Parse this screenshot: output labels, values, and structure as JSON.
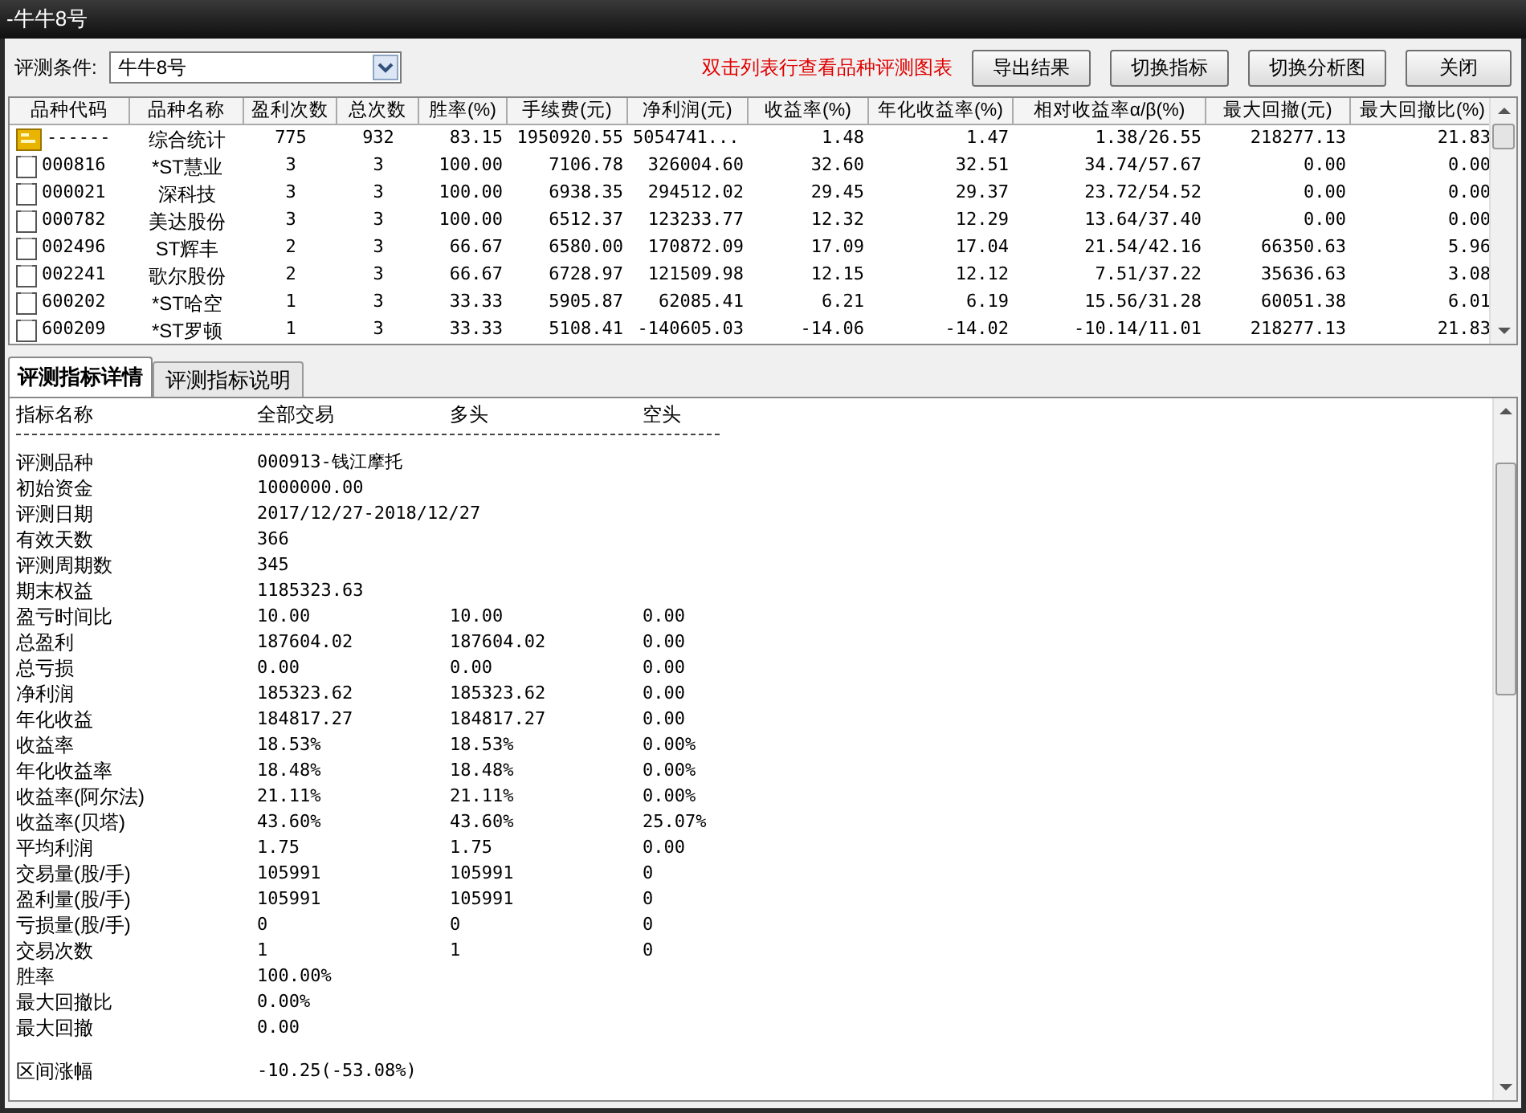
{
  "window": {
    "title": "-牛牛8号"
  },
  "toolbar": {
    "label": "评测条件:",
    "dropdown_value": "牛牛8号",
    "hint": "双击列表行查看品种评测图表",
    "buttons": [
      "导出结果",
      "切换指标",
      "切换分析图",
      "关闭"
    ]
  },
  "table": {
    "columns": [
      "品种代码",
      "品种名称",
      "盈利次数",
      "总次数",
      "胜率(%)",
      "手续费(元)",
      "净利润(元)",
      "收益率(%)",
      "年化收益率(%)",
      "相对收益率α/β(%)",
      "最大回撤(元)",
      "最大回撤比(%)"
    ],
    "rows": [
      {
        "kind": "summary",
        "cells": [
          "------",
          "综合统计",
          "775",
          "932",
          "83.15",
          "1950920.55",
          "5054741...",
          "1.48",
          "1.47",
          "1.38/26.55",
          "218277.13",
          "21.83"
        ]
      },
      {
        "kind": "stock",
        "cells": [
          "000816",
          "*ST慧业",
          "3",
          "3",
          "100.00",
          "7106.78",
          "326004.60",
          "32.60",
          "32.51",
          "34.74/57.67",
          "0.00",
          "0.00"
        ]
      },
      {
        "kind": "stock",
        "cells": [
          "000021",
          "深科技",
          "3",
          "3",
          "100.00",
          "6938.35",
          "294512.02",
          "29.45",
          "29.37",
          "23.72/54.52",
          "0.00",
          "0.00"
        ]
      },
      {
        "kind": "stock",
        "cells": [
          "000782",
          "美达股份",
          "3",
          "3",
          "100.00",
          "6512.37",
          "123233.77",
          "12.32",
          "12.29",
          "13.64/37.40",
          "0.00",
          "0.00"
        ]
      },
      {
        "kind": "stock",
        "cells": [
          "002496",
          "ST辉丰",
          "2",
          "3",
          "66.67",
          "6580.00",
          "170872.09",
          "17.09",
          "17.04",
          "21.54/42.16",
          "66350.63",
          "5.96"
        ]
      },
      {
        "kind": "stock",
        "cells": [
          "002241",
          "歌尔股份",
          "2",
          "3",
          "66.67",
          "6728.97",
          "121509.98",
          "12.15",
          "12.12",
          "7.51/37.22",
          "35636.63",
          "3.08"
        ]
      },
      {
        "kind": "stock",
        "cells": [
          "600202",
          "*ST哈空",
          "1",
          "3",
          "33.33",
          "5905.87",
          "62085.41",
          "6.21",
          "6.19",
          "15.56/31.28",
          "60051.38",
          "6.01"
        ]
      },
      {
        "kind": "stock",
        "cells": [
          "600209",
          "*ST罗顿",
          "1",
          "3",
          "33.33",
          "5108.41",
          "-140605.03",
          "-14.06",
          "-14.02",
          "-10.14/11.01",
          "218277.13",
          "21.83"
        ]
      }
    ]
  },
  "tabs": [
    {
      "label": "评测指标详情",
      "selected": true
    },
    {
      "label": "评测指标说明",
      "selected": false
    }
  ],
  "details": {
    "columns": [
      "指标名称",
      "全部交易",
      "多头",
      "空头"
    ],
    "rows": [
      {
        "cells": [
          "评测品种",
          "000913-钱江摩托"
        ]
      },
      {
        "cells": [
          "初始资金",
          "1000000.00"
        ]
      },
      {
        "cells": [
          "评测日期",
          "2017/12/27-2018/12/27"
        ]
      },
      {
        "cells": [
          "有效天数",
          "366"
        ]
      },
      {
        "cells": [
          "评测周期数",
          "345"
        ]
      },
      {
        "cells": [
          "期末权益",
          "1185323.63"
        ]
      },
      {
        "cells": [
          "盈亏时间比",
          "10.00",
          "10.00",
          "0.00"
        ]
      },
      {
        "cells": [
          "总盈利",
          "187604.02",
          "187604.02",
          "0.00"
        ]
      },
      {
        "cells": [
          "总亏损",
          "0.00",
          "0.00",
          "0.00"
        ]
      },
      {
        "cells": [
          "净利润",
          "185323.62",
          "185323.62",
          "0.00"
        ]
      },
      {
        "cells": [
          "年化收益",
          "184817.27",
          "184817.27",
          "0.00"
        ]
      },
      {
        "cells": [
          "收益率",
          "18.53%",
          "18.53%",
          "0.00%"
        ]
      },
      {
        "cells": [
          "年化收益率",
          "18.48%",
          "18.48%",
          "0.00%"
        ]
      },
      {
        "cells": [
          "收益率(阿尔法)",
          "21.11%",
          "21.11%",
          "0.00%"
        ]
      },
      {
        "cells": [
          "收益率(贝塔)",
          "43.60%",
          "43.60%",
          "25.07%"
        ]
      },
      {
        "cells": [
          "平均利润",
          "1.75",
          "1.75",
          "0.00"
        ]
      },
      {
        "cells": [
          "交易量(股/手)",
          "105991",
          "105991",
          "0"
        ]
      },
      {
        "cells": [
          "盈利量(股/手)",
          "105991",
          "105991",
          "0"
        ]
      },
      {
        "cells": [
          "亏损量(股/手)",
          "0",
          "0",
          "0"
        ]
      },
      {
        "cells": [
          "交易次数",
          "1",
          "1",
          "0"
        ]
      },
      {
        "cells": [
          "胜率",
          "100.00%"
        ]
      },
      {
        "cells": [
          "最大回撤比",
          "0.00%"
        ]
      },
      {
        "cells": [
          "最大回撤",
          "0.00"
        ]
      },
      {
        "cells": [
          "区间涨幅",
          "-10.25(-53.08%)"
        ],
        "gap_before": true
      }
    ]
  }
}
